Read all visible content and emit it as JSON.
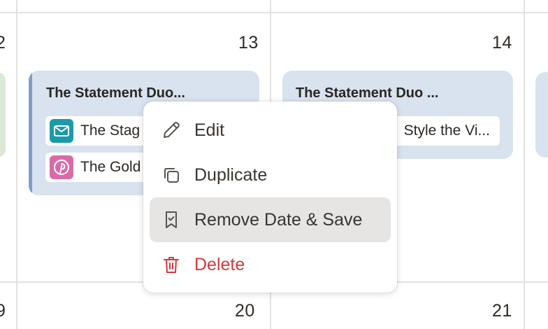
{
  "calendar": {
    "days": {
      "d12": "2",
      "d13": "13",
      "d14": "14",
      "d19": "9",
      "d20": "20",
      "d21": "21"
    },
    "events": [
      {
        "title": "The Statement Duo...",
        "items": [
          {
            "icon": "mail-icon",
            "label": "The Stag",
            "icon_color": "#1b9aaa"
          },
          {
            "icon": "pinterest-icon",
            "label": "The Gold",
            "icon_color": "#d96aa8"
          }
        ],
        "accent_color": "#7f9ccb"
      },
      {
        "title": "The Statement Duo ...",
        "items": [
          {
            "label": "Style the Vi..."
          }
        ]
      }
    ]
  },
  "context_menu": {
    "items": [
      {
        "label": "Edit",
        "icon": "pencil-icon"
      },
      {
        "label": "Duplicate",
        "icon": "copy-icon"
      },
      {
        "label": "Remove Date & Save",
        "icon": "bookmark-check-icon",
        "highlighted": true
      },
      {
        "label": "Delete",
        "icon": "trash-icon",
        "color": "#d1393f"
      }
    ]
  }
}
